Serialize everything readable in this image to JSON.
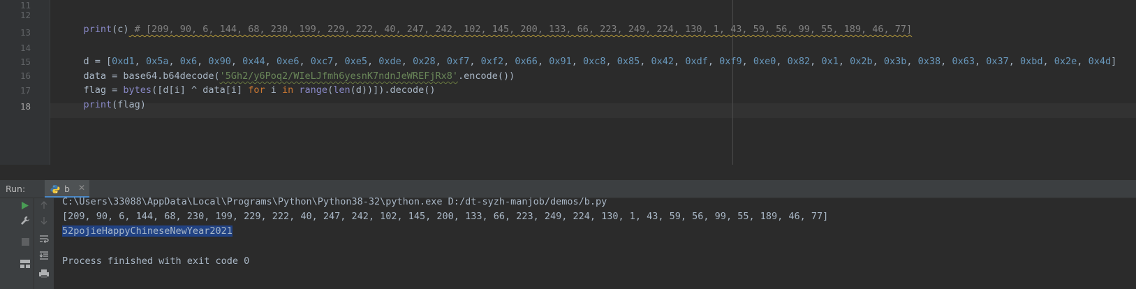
{
  "editor": {
    "line_numbers": [
      "11",
      "12",
      "13",
      "14",
      "15",
      "16",
      "17",
      "18"
    ],
    "current_line": "18",
    "line12": {
      "print": "print",
      "arg": "(c)",
      "comment": " # [209, 90, 6, 144, 68, 230, 199, 229, 222, 40, 247, 242, 102, 145, 200, 133, 66, 223, 249, 224, 130, 1, 43, 59, 56, 99, 55, 189, 46, 77]"
    },
    "line14": {
      "prefix": "d = [",
      "values": [
        "0xd1",
        "0x5a",
        "0x6",
        "0x90",
        "0x44",
        "0xe6",
        "0xc7",
        "0xe5",
        "0xde",
        "0x28",
        "0xf7",
        "0xf2",
        "0x66",
        "0x91",
        "0xc8",
        "0x85",
        "0x42",
        "0xdf",
        "0xf9",
        "0xe0",
        "0x82",
        "0x1",
        "0x2b",
        "0x3b",
        "0x38",
        "0x63",
        "0x37",
        "0xbd",
        "0x2e",
        "0x4d"
      ],
      "suffix": "]"
    },
    "line15": {
      "prefix": "data = base64.b64decode(",
      "string": "'5Gh2/y6Poq2/WIeLJfmh6yesnK7ndnJeWREFjRx8'",
      "suffix": ".encode())"
    },
    "line16": {
      "a": "flag = ",
      "bytes": "bytes",
      "b": "([d[i] ^ data[i] ",
      "for": "for",
      "c": " i ",
      "in": "in",
      "d": " ",
      "range": "range",
      "e": "(",
      "len": "len",
      "f": "(d))]).decode()"
    },
    "line17": {
      "print": "print",
      "arg": "(flag)"
    }
  },
  "run_panel": {
    "label": "Run:",
    "tab_name": "b",
    "tab_icon": "python-icon",
    "output": {
      "command": "C:\\Users\\33088\\AppData\\Local\\Programs\\Python\\Python38-32\\python.exe D:/dt-syzh-manjob/demos/b.py",
      "list": "[209, 90, 6, 144, 68, 230, 199, 229, 222, 40, 247, 242, 102, 145, 200, 133, 66, 223, 249, 224, 130, 1, 43, 59, 56, 99, 55, 189, 46, 77]",
      "flag": "52pojieHappyChineseNewYear2021",
      "exit": "Process finished with exit code 0"
    }
  },
  "colors": {
    "keyword": "#cc7832",
    "string": "#6a8759",
    "number": "#6897bb",
    "comment": "#808080",
    "builtin": "#8888c6",
    "selection": "#214283",
    "run_green": "#499c54"
  }
}
